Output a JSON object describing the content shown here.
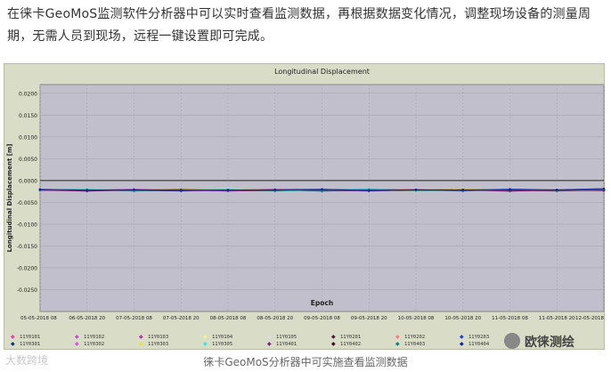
{
  "article": {
    "intro_text": "在徕卡GeoMoS监测软件分析器中可以实时查看监测数据，再根据数据变化情况，调整现场设备的测量周期，无需人员到现场，远程一键设置即可完成。",
    "caption": "徕卡GeoMoS分析器中可实施查看监测数据",
    "watermark_left": "大数跨境",
    "watermark_right": "欧徕测绘"
  },
  "colors": {
    "plot_bg": "#c0bfcb",
    "frame_bg": "#d9dcc6",
    "zero_line": "#202020"
  },
  "chart_data": {
    "type": "line",
    "title": "Longitudinal Displacement",
    "xlabel": "Epoch",
    "ylabel": "Longitudinal Displacement [m]",
    "ylim": [
      -0.03,
      0.022
    ],
    "yticks": [
      "0.0200",
      "0.0150",
      "0.0100",
      "0.0050",
      "0.0000",
      "-0.0050",
      "-0.0100",
      "-0.0150",
      "-0.0200",
      "-0.0250"
    ],
    "ytick_values": [
      0.02,
      0.015,
      0.01,
      0.005,
      0.0,
      -0.005,
      -0.01,
      -0.015,
      -0.02,
      -0.025
    ],
    "xticks": [
      "05-05-2018 08",
      "06-05-2018 20",
      "07-05-2018 08",
      "07-05-2018 20",
      "08-05-2018 08",
      "08-05-2018 20",
      "09-05-2018 08",
      "09-05-2018 20",
      "10-05-2018 08",
      "10-05-2018 20",
      "11-05-2018 08",
      "11-05-2018 20",
      "12-05-2018"
    ],
    "grid": true,
    "legend_position": "bottom",
    "series": [
      {
        "name": "11Y0101",
        "color": "#e040a0",
        "values": [
          -0.002,
          -0.0023,
          -0.0021,
          -0.0024,
          -0.0022,
          -0.002,
          -0.0023,
          -0.0021,
          -0.0022,
          -0.0024,
          -0.0021,
          -0.0023,
          -0.002
        ]
      },
      {
        "name": "11Y0102",
        "color": "#c050c0",
        "values": [
          -0.0022,
          -0.0021,
          -0.0024,
          -0.0022,
          -0.0023,
          -0.0021,
          -0.0022,
          -0.0024,
          -0.0021,
          -0.0022,
          -0.0023,
          -0.002,
          -0.0022
        ]
      },
      {
        "name": "11Y0103",
        "color": "#b030b0",
        "values": [
          -0.0021,
          -0.0024,
          -0.0022,
          -0.0021,
          -0.0024,
          -0.0022,
          -0.0021,
          -0.0023,
          -0.0022,
          -0.0021,
          -0.0024,
          -0.0022,
          -0.0021
        ]
      },
      {
        "name": "11Y0104",
        "color": "#f0f0a0",
        "values": [
          -0.0019,
          -0.0021,
          -0.002,
          -0.0022,
          -0.0019,
          -0.0021,
          -0.002,
          -0.0022,
          -0.0019,
          -0.002,
          -0.0021,
          -0.0019,
          -0.002
        ]
      },
      {
        "name": "11Y0105",
        "color": "#f8f8f8",
        "values": [
          -0.0023,
          -0.002,
          -0.0022,
          -0.0021,
          -0.0023,
          -0.002,
          -0.0022,
          -0.0021,
          -0.0023,
          -0.002,
          -0.0022,
          -0.0021,
          -0.0023
        ]
      },
      {
        "name": "11Y0201",
        "color": "#4a1a3a",
        "values": [
          -0.0022,
          -0.0022,
          -0.0023,
          -0.0023,
          -0.0021,
          -0.0022,
          -0.0023,
          -0.0022,
          -0.0023,
          -0.0022,
          -0.0022,
          -0.0023,
          -0.0021
        ]
      },
      {
        "name": "11Y0202",
        "color": "#f08080",
        "values": [
          -0.002,
          -0.0022,
          -0.0021,
          -0.0023,
          -0.0022,
          -0.002,
          -0.0021,
          -0.0022,
          -0.002,
          -0.0023,
          -0.0021,
          -0.0022,
          -0.002
        ]
      },
      {
        "name": "11Y0203",
        "color": "#2040d0",
        "values": [
          -0.0021,
          -0.0023,
          -0.0022,
          -0.002,
          -0.0022,
          -0.0023,
          -0.0021,
          -0.002,
          -0.0022,
          -0.0023,
          -0.0021,
          -0.0022,
          -0.0019
        ]
      },
      {
        "name": "11Y0301",
        "color": "#103070",
        "values": [
          -0.0022,
          -0.0021,
          -0.0022,
          -0.0023,
          -0.0021,
          -0.0022,
          -0.0022,
          -0.0021,
          -0.0022,
          -0.0021,
          -0.0023,
          -0.0021,
          -0.0022
        ]
      },
      {
        "name": "11Y0302",
        "color": "#e050e0",
        "values": [
          -0.0023,
          -0.0022,
          -0.002,
          -0.0022,
          -0.0024,
          -0.0021,
          -0.0023,
          -0.0022,
          -0.0021,
          -0.0023,
          -0.0022,
          -0.0024,
          -0.0021
        ]
      },
      {
        "name": "11Y0303",
        "color": "#f0e040",
        "values": [
          -0.002,
          -0.0023,
          -0.0022,
          -0.002,
          -0.0021,
          -0.0023,
          -0.002,
          -0.0022,
          -0.0023,
          -0.002,
          -0.0021,
          -0.0022,
          -0.002
        ]
      },
      {
        "name": "11Y0305",
        "color": "#40e0e0",
        "values": [
          -0.0021,
          -0.002,
          -0.0023,
          -0.0022,
          -0.002,
          -0.0024,
          -0.0022,
          -0.002,
          -0.0023,
          -0.0022,
          -0.002,
          -0.0023,
          -0.0022
        ]
      },
      {
        "name": "11Y0401",
        "color": "#802080",
        "values": [
          -0.0022,
          -0.0024,
          -0.0021,
          -0.0022,
          -0.0023,
          -0.0021,
          -0.0024,
          -0.0022,
          -0.0021,
          -0.0022,
          -0.0024,
          -0.0021,
          -0.0023
        ]
      },
      {
        "name": "11Y0402",
        "color": "#3a0a1a",
        "values": [
          -0.0021,
          -0.0022,
          -0.0022,
          -0.0021,
          -0.0022,
          -0.0023,
          -0.0021,
          -0.0023,
          -0.0022,
          -0.0021,
          -0.0022,
          -0.0023,
          -0.0022
        ]
      },
      {
        "name": "11Y0403",
        "color": "#108080",
        "values": [
          -0.0022,
          -0.0021,
          -0.0023,
          -0.0022,
          -0.0021,
          -0.0022,
          -0.0023,
          -0.0021,
          -0.0022,
          -0.0023,
          -0.0021,
          -0.0022,
          -0.0021
        ]
      },
      {
        "name": "11Y0404",
        "color": "#1020a0",
        "values": [
          -0.002,
          -0.0022,
          -0.0021,
          -0.0023,
          -0.0022,
          -0.0021,
          -0.002,
          -0.0023,
          -0.0021,
          -0.0022,
          -0.002,
          -0.0021,
          -0.0019
        ]
      }
    ]
  }
}
